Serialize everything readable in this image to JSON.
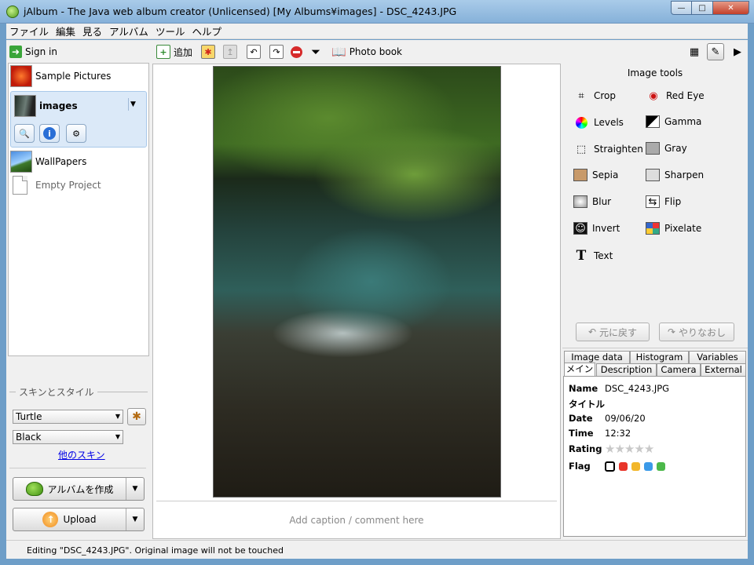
{
  "window": {
    "title": "jAlbum - The Java web album creator (Unlicensed) [My Albums¥images] - DSC_4243.JPG",
    "controls": {
      "minimize": "—",
      "maximize": "□",
      "close": "✕"
    }
  },
  "menu": [
    "ファイル",
    "編集",
    "見る",
    "アルバム",
    "ツール",
    "ヘルプ"
  ],
  "sidebar": {
    "sign_in": "Sign in",
    "projects": [
      {
        "label": "Sample Pictures",
        "thumb": "sample-thumbnail"
      },
      {
        "label": "images",
        "thumb": "images-thumbnail",
        "selected": true
      },
      {
        "label": "WallPapers",
        "thumb": "wallpapers-thumbnail"
      },
      {
        "label": "Empty Project",
        "thumb": "empty-project-icon"
      }
    ],
    "skin_section_title": "スキンとスタイル",
    "skin": "Turtle",
    "style": "Black",
    "more_skins": "他のスキン",
    "make_album": "アルバムを作成",
    "upload": "Upload"
  },
  "toolbar": {
    "add": "追加",
    "photo_book": "Photo book"
  },
  "editor": {
    "caption_placeholder": "Add caption / comment here"
  },
  "image_tools": {
    "title": "Image tools",
    "tools": [
      "Crop",
      "Red Eye",
      "Levels",
      "Gamma",
      "Straighten",
      "Gray",
      "Sepia",
      "Sharpen",
      "Blur",
      "Flip",
      "Invert",
      "Pixelate",
      "Text"
    ],
    "undo": "元に戻す",
    "redo": "やりなおし"
  },
  "properties": {
    "tabs_top": [
      "Image data",
      "Histogram",
      "Variables"
    ],
    "tabs_bottom": [
      "メイン",
      "Description",
      "Camera",
      "External"
    ],
    "labels": {
      "name": "Name",
      "title": "タイトル",
      "date": "Date",
      "time": "Time",
      "rating": "Rating",
      "flag": "Flag"
    },
    "values": {
      "name": "DSC_4243.JPG",
      "title": "",
      "date": "09/06/20",
      "time": "12:32"
    },
    "rating": 0,
    "flag_colors": [
      "#ffffff",
      "#e8352a",
      "#f2b62a",
      "#3b9ae8",
      "#4cb84a"
    ]
  },
  "status": "Editing \"DSC_4243.JPG\". Original image will not be touched"
}
